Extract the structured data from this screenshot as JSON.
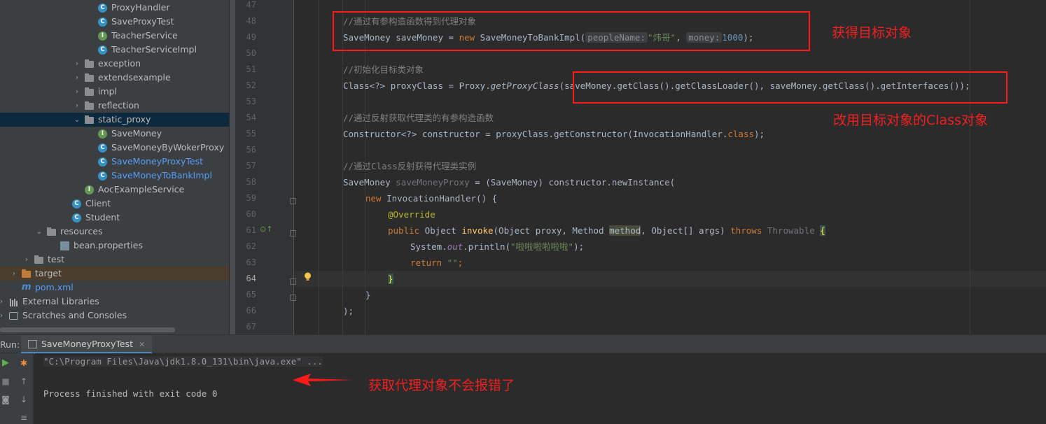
{
  "project_tree": [
    {
      "label": "ProxyHandler",
      "icon": "class",
      "indent": 145,
      "chevron": ""
    },
    {
      "label": "SaveProxyTest",
      "icon": "class",
      "indent": 145,
      "chevron": ""
    },
    {
      "label": "TeacherService",
      "icon": "interface",
      "indent": 145,
      "chevron": ""
    },
    {
      "label": "TeacherServiceImpl",
      "icon": "class",
      "indent": 145,
      "chevron": ""
    },
    {
      "label": "exception",
      "icon": "package",
      "indent": 126,
      "chevron": "›"
    },
    {
      "label": "extendsexample",
      "icon": "package",
      "indent": 126,
      "chevron": "›"
    },
    {
      "label": "impl",
      "icon": "package",
      "indent": 126,
      "chevron": "›"
    },
    {
      "label": "reflection",
      "icon": "package",
      "indent": 126,
      "chevron": "›"
    },
    {
      "label": "static_proxy",
      "icon": "package",
      "indent": 126,
      "chevron": "⌄",
      "selected": true
    },
    {
      "label": "SaveMoney",
      "icon": "interface",
      "indent": 145,
      "chevron": ""
    },
    {
      "label": "SaveMoneyByWokerProxy",
      "icon": "class",
      "indent": 145,
      "chevron": ""
    },
    {
      "label": "SaveMoneyProxyTest",
      "icon": "class",
      "indent": 145,
      "chevron": "",
      "blue": true
    },
    {
      "label": "SaveMoneyToBankImpl",
      "icon": "class",
      "indent": 145,
      "chevron": "",
      "blue": true
    },
    {
      "label": "AocExampleService",
      "icon": "interface",
      "indent": 126,
      "chevron": ""
    },
    {
      "label": "Client",
      "icon": "class",
      "indent": 108,
      "chevron": ""
    },
    {
      "label": "Student",
      "icon": "class",
      "indent": 108,
      "chevron": ""
    },
    {
      "label": "resources",
      "icon": "resources-folder",
      "indent": 72,
      "chevron": "⌄"
    },
    {
      "label": "bean.properties",
      "icon": "properties",
      "indent": 91,
      "chevron": ""
    },
    {
      "label": "test",
      "icon": "folder",
      "indent": 54,
      "chevron": "›"
    },
    {
      "label": "target",
      "icon": "folder-orange",
      "indent": 36,
      "chevron": "›",
      "target": true
    },
    {
      "label": "pom.xml",
      "icon": "maven",
      "indent": 36,
      "chevron": "",
      "blue": true
    },
    {
      "label": "External Libraries",
      "icon": "libraries",
      "indent": 18,
      "chevron": "›"
    },
    {
      "label": "Scratches and Consoles",
      "icon": "scratches",
      "indent": 18,
      "chevron": "›"
    }
  ],
  "editor": {
    "line_numbers": [
      "47",
      "48",
      "49",
      "50",
      "51",
      "52",
      "53",
      "54",
      "55",
      "56",
      "57",
      "58",
      "59",
      "60",
      "61",
      "62",
      "63",
      "64",
      "65",
      "66",
      "67"
    ],
    "current_line": "64",
    "code": {
      "l48_comment": "//通过有参构造函数得到代理对象",
      "l49_a": "SaveMoney saveMoney = ",
      "l49_new": "new",
      "l49_b": " SaveMoneyToBankImpl(",
      "l49_hint1": "peopleName:",
      "l49_str": "\"炜哥\"",
      "l49_comma": ",",
      "l49_hint2": "money:",
      "l49_num": "1000",
      "l49_end": ");",
      "l51_comment": "//初始化目标类对象",
      "l52_a": "Class<?> proxyClass = Proxy.",
      "l52_method": "getProxyClass",
      "l52_b": "(saveMoney.getClass().getClassLoader(), saveMoney.getClass().getInterfaces());",
      "l54_comment": "//通过反射获取代理类的有参构造函数",
      "l55_a": "Constructor<?> constructor = proxyClass.getConstructor(InvocationHandler.",
      "l55_class": "class",
      "l55_end": ");",
      "l57_comment": "//通过Class反射获得代理类实例",
      "l58_a": "SaveMoney ",
      "l58_var": "saveMoneyProxy",
      "l58_b": " = (SaveMoney) constructor.newInstance(",
      "l59_new": "new",
      "l59_b": " InvocationHandler() {",
      "l60_ann": "@Override",
      "l61_public": "public",
      "l61_a": " Object ",
      "l61_invoke": "invoke",
      "l61_b": "(Object proxy, Method ",
      "l61_method": "method",
      "l61_c": ", Object[] args) ",
      "l61_throws": "throws",
      "l61_throwable": " Throwable ",
      "l61_brace": "{",
      "l62_a": "System.",
      "l62_out": "out",
      "l62_b": ".println(",
      "l62_str": "\"啦啦啦啦啦啦\"",
      "l62_end": ");",
      "l63_return": "return",
      "l63_str": " \"\"",
      "l63_end": ";",
      "l64_brace": "}",
      "l65_brace": "}",
      "l66_end": ");"
    }
  },
  "annotations": {
    "target_object": "获得目标对象",
    "use_class_object": "改用目标对象的Class对象",
    "no_error": "获取代理对象不会报错了"
  },
  "run_panel": {
    "title": "Run:",
    "tab_label": "SaveMoneyProxyTest",
    "command_line": "\"C:\\Program Files\\Java\\jdk1.8.0_131\\bin\\java.exe\" ...",
    "exit_message": "Process finished with exit code 0"
  },
  "colors": {
    "annotation_red": "#ff1a1a",
    "keyword": "#cc7832",
    "string": "#6a8759",
    "comment": "#808080"
  }
}
